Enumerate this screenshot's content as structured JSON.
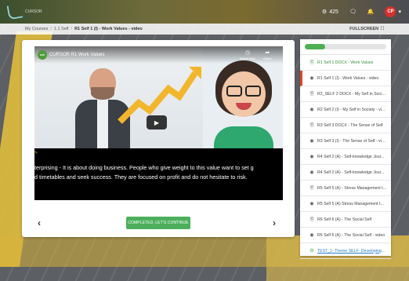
{
  "brand": {
    "logo_text": "CURSOR"
  },
  "topbar": {
    "points": "425",
    "points_icon": "gear-badge-icon",
    "chat_icon": "chat-icon",
    "bell_icon": "bell-icon",
    "avatar_initials": "CP",
    "avatar_color": "#d6302b"
  },
  "breadcrumb": {
    "items": [
      "My Courses",
      "1.1 Self"
    ],
    "current": "R1 Self 1 (I) - Work Values - video",
    "fullscreen_label": "FULLSCREEN"
  },
  "video": {
    "title": "CURSOR R1 Work Values",
    "logo_label": "ESP",
    "watch_later_label": "Watch later",
    "share_label": "Share",
    "subtitle_line1": "terprising - It is about doing business. People who give weight to this value want to set g",
    "subtitle_line2": "d timetables and seek success. They are focused on profit and do not hesitate to risk."
  },
  "navigation": {
    "prev_symbol": "‹",
    "next_symbol": "›",
    "complete_label": "COMPLETED, LET'S CONTINUE",
    "complete_color": "#4caf5c"
  },
  "progress": {
    "fraction": 0.25,
    "color": "#4caf50"
  },
  "lessons": [
    {
      "label": "R1 Self 1 DOCX - Work Values",
      "icon": "document-icon",
      "state": "done"
    },
    {
      "label": "R1 Self 1 (I) - Work Values - video",
      "icon": "video-icon",
      "state": "active"
    },
    {
      "label": "R2_SELF 2 DOCX - My Self in Society",
      "icon": "document-icon",
      "state": "normal"
    },
    {
      "label": "R2 Self 2 (I) - My Self in Society - vi...",
      "icon": "video-icon",
      "state": "normal"
    },
    {
      "label": "R3 Self 3 DOCX - The Sense of Self",
      "icon": "document-icon",
      "state": "normal"
    },
    {
      "label": "R3 Self 3 (I) - The Sense of Self - vid...",
      "icon": "video-icon",
      "state": "normal"
    },
    {
      "label": "R4 Self 2 (A) - Self-knowledge Jour...",
      "icon": "video-icon",
      "state": "normal"
    },
    {
      "label": "R4 Self 2 (A) - Self-knowledge Jour...",
      "icon": "video-icon",
      "state": "normal"
    },
    {
      "label": "R5 Self 5 (A) - Stress Management t...",
      "icon": "document-icon",
      "state": "normal"
    },
    {
      "label": "R5 Self 5 (A) Stress Management t...",
      "icon": "video-icon",
      "state": "normal"
    },
    {
      "label": "R6 Self 6 (A) - The Social Self",
      "icon": "document-icon",
      "state": "normal"
    },
    {
      "label": "R6 Self 6 (A) - The Social Self - video",
      "icon": "video-icon",
      "state": "normal"
    },
    {
      "label": "TEST_1- Theme SELF- Developing a...",
      "icon": "quiz-icon",
      "state": "test"
    }
  ]
}
